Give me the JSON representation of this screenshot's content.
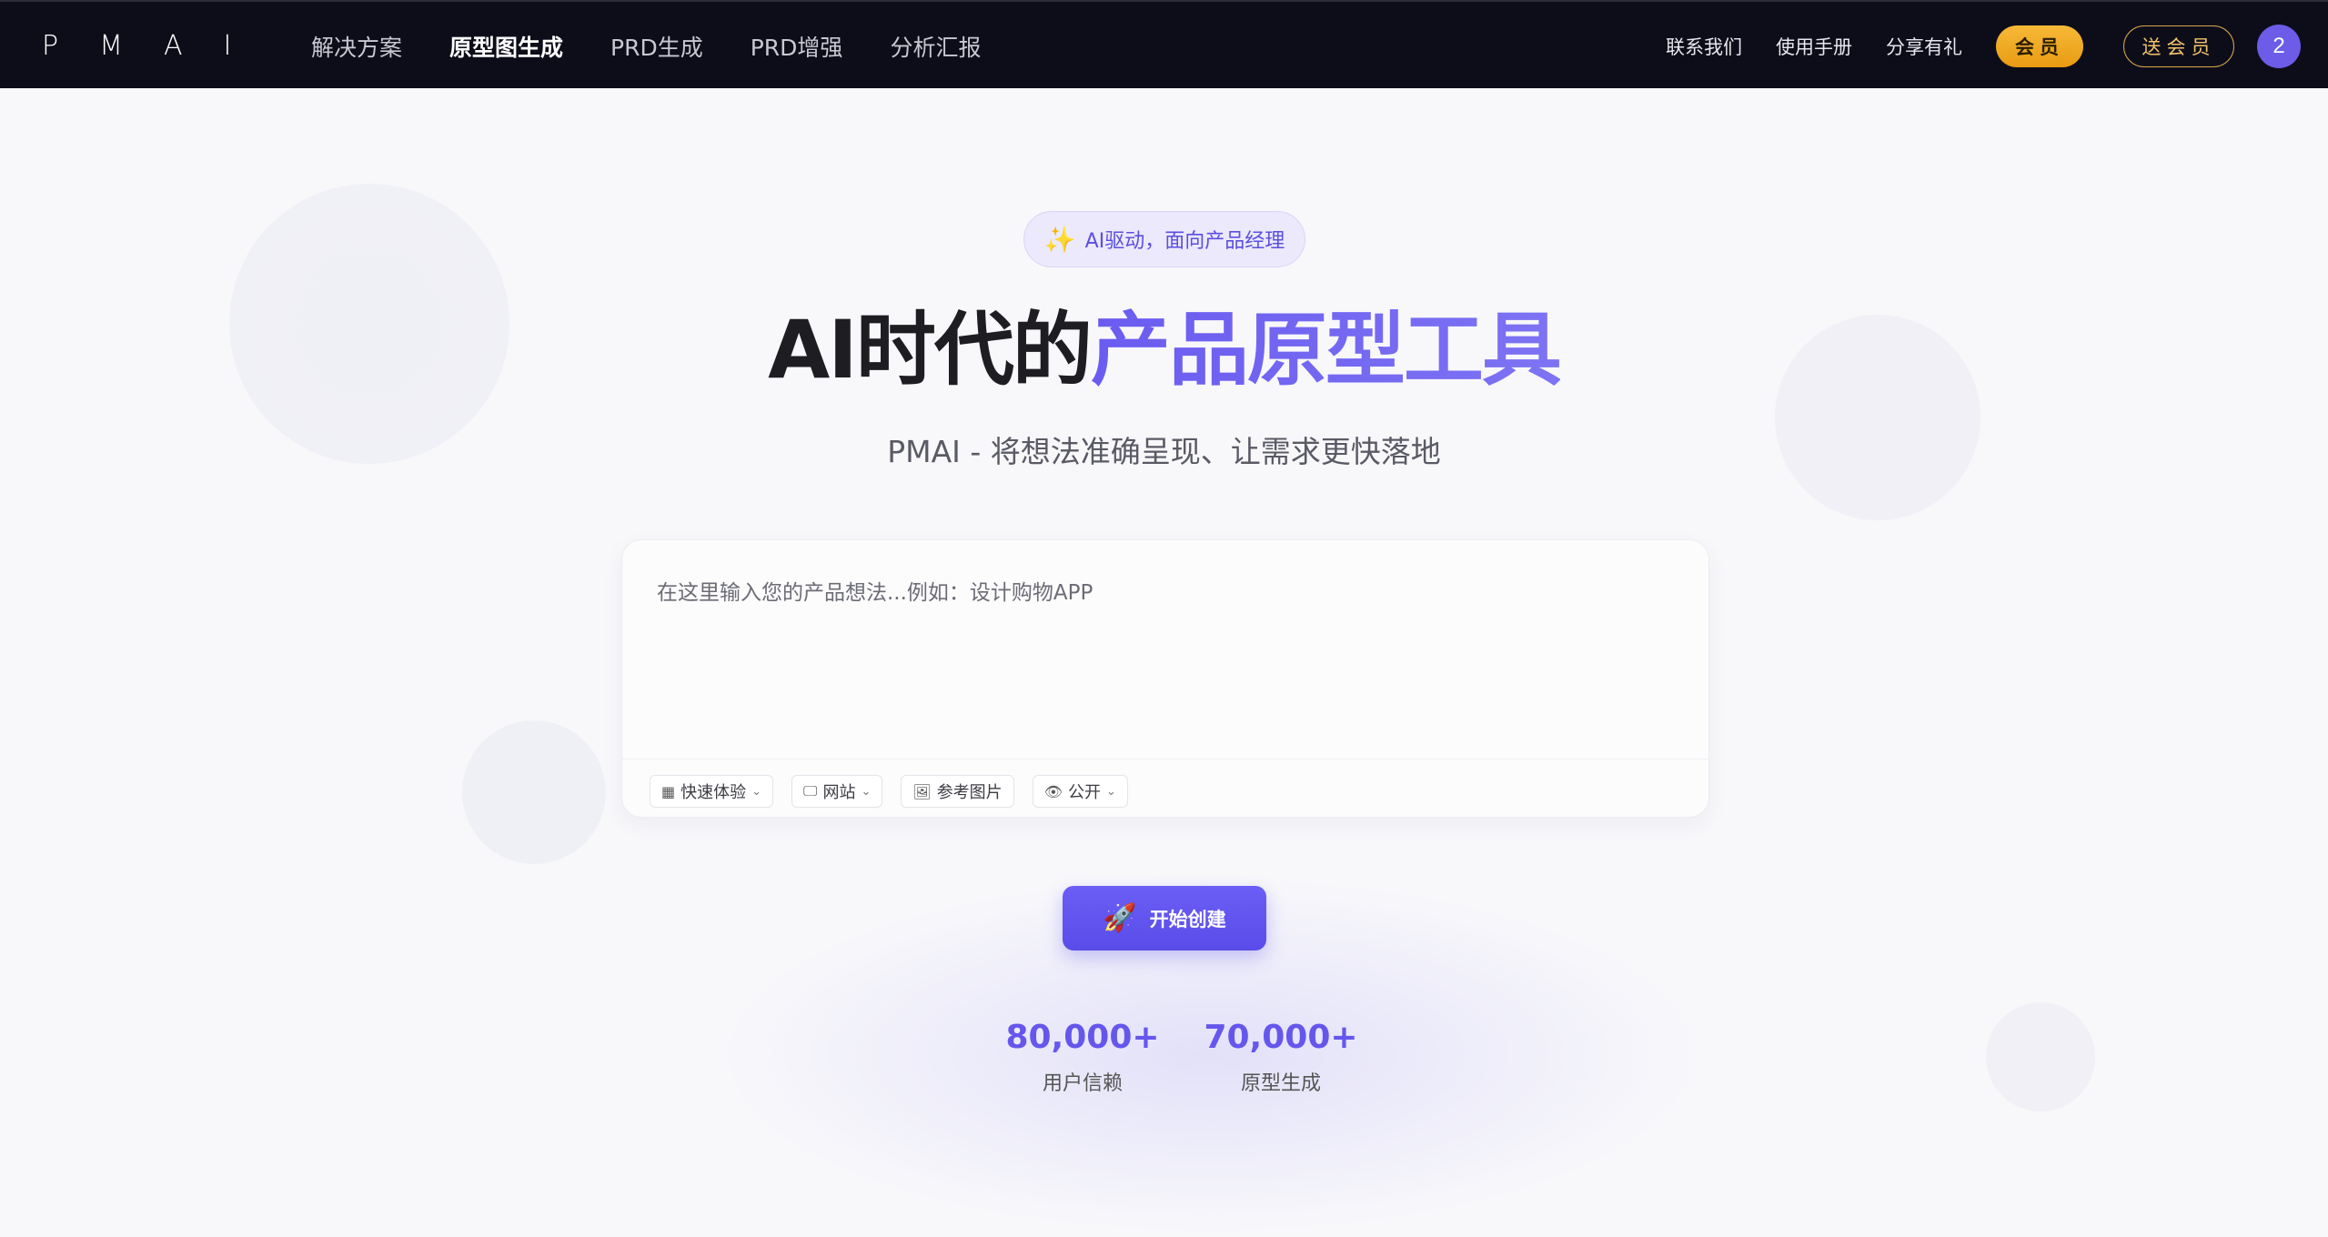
{
  "nav": {
    "logo": "PMAI",
    "links": [
      "解决方案",
      "原型图生成",
      "PRD生成",
      "PRD增强",
      "分析汇报"
    ],
    "active_index": 1,
    "right_links": [
      "联系我们",
      "使用手册",
      "分享有礼"
    ],
    "vip_label": "会员",
    "gift_vip_label": "送会员",
    "avatar_initial": "2"
  },
  "hero": {
    "badge_icon": "sparkles-icon",
    "badge_text": "AI驱动，面向产品经理",
    "title_plain": "AI时代的",
    "title_accent": "产品原型工具",
    "subtitle": "PMAI - 将想法准确呈现、让需求更快落地"
  },
  "prompt_card": {
    "placeholder": "在这里输入您的产品想法...例如：设计购物APP",
    "value": "",
    "tools": [
      {
        "label": "快速体验",
        "icon": "grid-icon",
        "has_dropdown": true
      },
      {
        "label": "网站",
        "icon": "monitor-icon",
        "has_dropdown": true
      },
      {
        "label": "参考图片",
        "icon": "image-icon",
        "has_dropdown": false
      },
      {
        "label": "公开",
        "icon": "eye-icon",
        "has_dropdown": true
      }
    ]
  },
  "cta": {
    "label": "开始创建",
    "icon": "rocket-icon"
  },
  "stats": [
    {
      "value": "80,000",
      "suffix": "+",
      "label": "用户信赖"
    },
    {
      "value": "70,000",
      "suffix": "+",
      "label": "原型生成"
    }
  ],
  "colors": {
    "accent": "#6557ec",
    "nav_bg": "#0d0d1a",
    "vip_gold": "#f0aa20"
  }
}
